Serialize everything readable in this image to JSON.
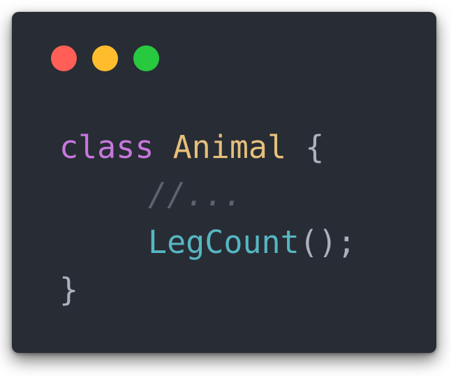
{
  "window": {
    "dots": [
      {
        "name": "close",
        "color": "#ff5f56"
      },
      {
        "name": "minimize",
        "color": "#ffbd2e"
      },
      {
        "name": "zoom",
        "color": "#27c93f"
      }
    ]
  },
  "code": {
    "line1": {
      "keyword": "class",
      "class_name": "Animal",
      "open_brace": "{"
    },
    "line2": {
      "comment": "//..."
    },
    "line3": {
      "method": "LegCount",
      "call": "();"
    },
    "line4": {
      "close_brace": "}"
    }
  },
  "colors": {
    "background": "#282c34",
    "keyword": "#c678dd",
    "class_name": "#e5c07b",
    "punctuation": "#abb2bf",
    "comment": "#5c6370",
    "method": "#56b6c2"
  },
  "icons": [
    "close-dot-icon",
    "minimize-dot-icon",
    "zoom-dot-icon"
  ]
}
